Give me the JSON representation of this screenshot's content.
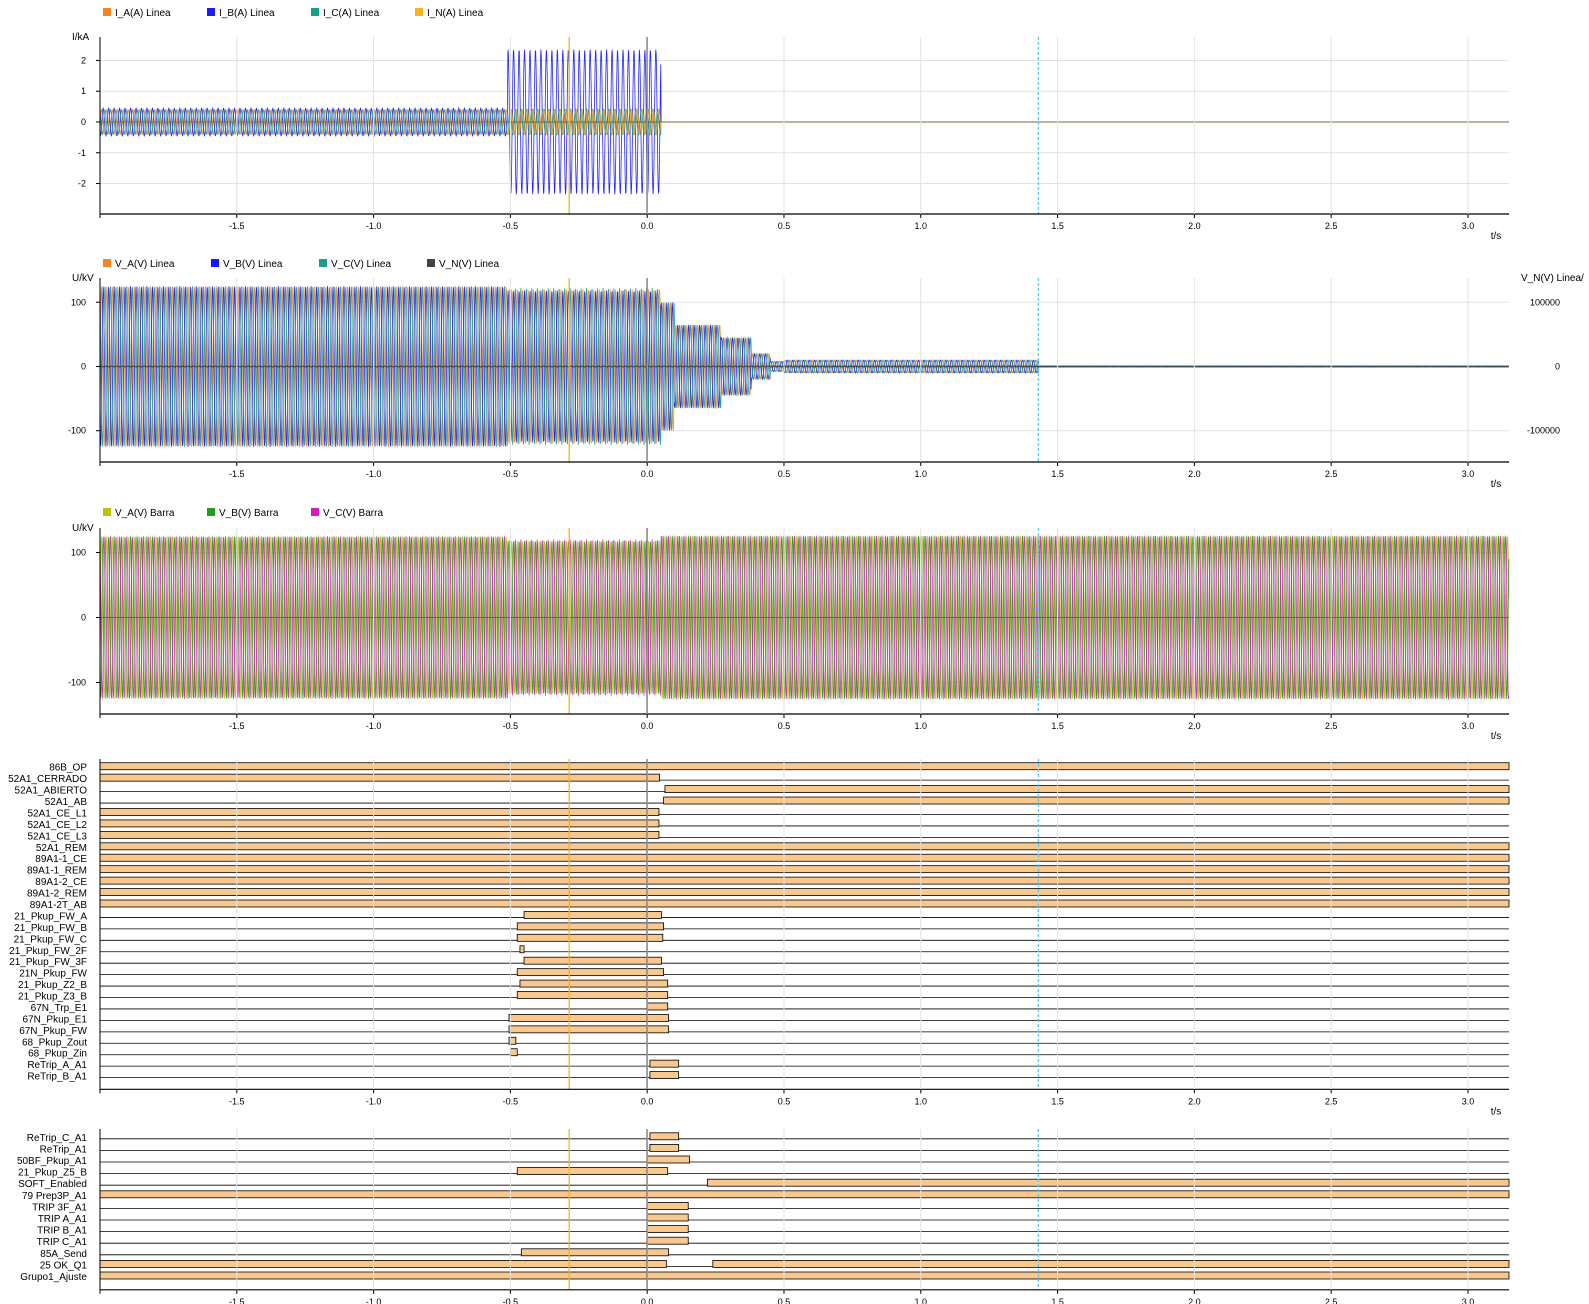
{
  "x_axis": {
    "unit_label": "t/s",
    "ticks": [
      -1.5,
      -1.0,
      -0.5,
      0.0,
      0.5,
      1.0,
      1.5,
      2.0,
      2.5,
      3.0
    ],
    "tick_labels": [
      "-1.5",
      "-1.0",
      "-0.5",
      "0.0",
      "0.5",
      "1.0",
      "1.5",
      "2.0",
      "2.5",
      "3.0"
    ],
    "range": [
      -2.0,
      3.15
    ]
  },
  "cursors": [
    {
      "name": "cursor-1",
      "t": -0.285,
      "color": "#f4b41a"
    },
    {
      "name": "cursor-2",
      "t": 1.43,
      "color": "#5ec8f0"
    },
    {
      "name": "trigger",
      "t": 0.0,
      "color": "#000000"
    }
  ],
  "chart_data": [
    {
      "type": "line",
      "ylabel": "I/kA",
      "ylim": [
        -2.6,
        2.6
      ],
      "yticks": [
        -2,
        -1,
        0,
        1,
        2
      ],
      "legend": "top-left",
      "series": [
        {
          "name": "I_A(A) Linea",
          "color": "#f7841e",
          "segments": [
            [
              -2.0,
              -0.51,
              0.4
            ],
            [
              -0.51,
              0.05,
              0.4
            ],
            [
              0.05,
              3.15,
              0
            ]
          ]
        },
        {
          "name": "I_B(A) Linea",
          "color": "#1a1aff",
          "segments": [
            [
              -2.0,
              -0.51,
              0.45
            ],
            [
              -0.51,
              0.05,
              2.35
            ],
            [
              0.05,
              3.15,
              0
            ]
          ]
        },
        {
          "name": "I_C(A) Linea",
          "color": "#1b9e8a",
          "segments": [
            [
              -2.0,
              -0.51,
              0.4
            ],
            [
              -0.51,
              0.05,
              0.42
            ],
            [
              0.05,
              3.15,
              0
            ]
          ]
        },
        {
          "name": "I_N(A) Linea",
          "color": "#f4b41a",
          "segments": [
            [
              -2.0,
              -0.51,
              0.02
            ],
            [
              -0.51,
              0.05,
              0.4
            ],
            [
              0.05,
              3.15,
              0
            ]
          ]
        }
      ]
    },
    {
      "type": "line",
      "ylabel": "U/kV",
      "ylim": [
        -130,
        130
      ],
      "yticks": [
        -100,
        0,
        100
      ],
      "y2label": "V_N(V) Linea/",
      "y2ticks": [
        -100000,
        0,
        100000
      ],
      "legend": "top-left",
      "series": [
        {
          "name": "V_A(V) Linea",
          "color": "#f7841e",
          "segments": [
            [
              -2.0,
              -0.51,
              125
            ],
            [
              -0.51,
              0.05,
              120
            ],
            [
              0.05,
              0.1,
              100
            ],
            [
              0.1,
              0.27,
              65
            ],
            [
              0.27,
              0.38,
              45
            ],
            [
              0.38,
              0.45,
              20
            ],
            [
              0.45,
              0.5,
              8
            ],
            [
              0.5,
              1.43,
              10
            ],
            [
              1.43,
              3.15,
              1
            ]
          ]
        },
        {
          "name": "V_B(V) Linea",
          "color": "#1a1aff",
          "segments": [
            [
              -2.0,
              -0.51,
              125
            ],
            [
              -0.51,
              0.05,
              118
            ],
            [
              0.05,
              0.1,
              100
            ],
            [
              0.1,
              0.27,
              65
            ],
            [
              0.27,
              0.38,
              45
            ],
            [
              0.38,
              0.45,
              20
            ],
            [
              0.45,
              0.5,
              8
            ],
            [
              0.5,
              1.43,
              10
            ],
            [
              1.43,
              3.15,
              1
            ]
          ]
        },
        {
          "name": "V_C(V) Linea",
          "color": "#1b9e8a",
          "segments": [
            [
              -2.0,
              -0.51,
              125
            ],
            [
              -0.51,
              0.05,
              122
            ],
            [
              0.05,
              0.1,
              100
            ],
            [
              0.1,
              0.27,
              65
            ],
            [
              0.27,
              0.38,
              45
            ],
            [
              0.38,
              0.45,
              20
            ],
            [
              0.45,
              0.5,
              8
            ],
            [
              0.5,
              1.43,
              10
            ],
            [
              1.43,
              3.15,
              1
            ]
          ]
        },
        {
          "name": "V_N(V) Linea",
          "color": "#444444",
          "segments": [
            [
              -2.0,
              3.15,
              1
            ]
          ]
        }
      ]
    },
    {
      "type": "line",
      "ylabel": "U/kV",
      "ylim": [
        -130,
        130
      ],
      "yticks": [
        -100,
        0,
        100
      ],
      "legend": "top-left",
      "series": [
        {
          "name": "V_A(V) Barra",
          "color": "#b8c400",
          "segments": [
            [
              -2.0,
              -0.51,
              125
            ],
            [
              -0.51,
              0.05,
              118
            ],
            [
              0.05,
              3.15,
              126
            ]
          ]
        },
        {
          "name": "V_B(V) Barra",
          "color": "#1e9e1e",
          "segments": [
            [
              -2.0,
              -0.51,
              125
            ],
            [
              -0.51,
              0.05,
              118
            ],
            [
              0.05,
              3.15,
              126
            ]
          ]
        },
        {
          "name": "V_C(V) Barra",
          "color": "#d41ec0",
          "segments": [
            [
              -2.0,
              -0.51,
              125
            ],
            [
              -0.51,
              0.05,
              120
            ],
            [
              0.05,
              3.15,
              126
            ]
          ]
        }
      ]
    },
    {
      "type": "digital",
      "channels": [
        {
          "name": "86B_OP",
          "on": [
            [
              -2.0,
              3.15
            ]
          ]
        },
        {
          "name": "52A1_CERRADO",
          "on": [
            [
              -2.0,
              0.045
            ]
          ]
        },
        {
          "name": "52A1_ABIERTO",
          "on": [
            [
              0.065,
              3.15
            ]
          ]
        },
        {
          "name": "52A1_AB",
          "on": [
            [
              0.06,
              3.15
            ]
          ]
        },
        {
          "name": "52A1_CE_L1",
          "on": [
            [
              -2.0,
              0.043
            ]
          ]
        },
        {
          "name": "52A1_CE_L2",
          "on": [
            [
              -2.0,
              0.043
            ]
          ]
        },
        {
          "name": "52A1_CE_L3",
          "on": [
            [
              -2.0,
              0.043
            ]
          ]
        },
        {
          "name": "52A1_REM",
          "on": [
            [
              -2.0,
              3.15
            ]
          ]
        },
        {
          "name": "89A1-1_CE",
          "on": [
            [
              -2.0,
              3.15
            ]
          ]
        },
        {
          "name": "89A1-1_REM",
          "on": [
            [
              -2.0,
              3.15
            ]
          ]
        },
        {
          "name": "89A1-2_CE",
          "on": [
            [
              -2.0,
              3.15
            ]
          ]
        },
        {
          "name": "89A1-2_REM",
          "on": [
            [
              -2.0,
              3.15
            ]
          ]
        },
        {
          "name": "89A1-2T_AB",
          "on": [
            [
              -2.0,
              3.15
            ]
          ]
        },
        {
          "name": "21_Pkup_FW_A",
          "on": [
            [
              -0.45,
              0.052
            ]
          ]
        },
        {
          "name": "21_Pkup_FW_B",
          "on": [
            [
              -0.475,
              0.06
            ]
          ]
        },
        {
          "name": "21_Pkup_FW_C",
          "on": [
            [
              -0.475,
              0.057
            ]
          ]
        },
        {
          "name": "21_Pkup_FW_2F",
          "on": [
            [
              -0.465,
              -0.45
            ]
          ]
        },
        {
          "name": "21_Pkup_FW_3F",
          "on": [
            [
              -0.45,
              0.052
            ]
          ]
        },
        {
          "name": "21N_Pkup_FW",
          "on": [
            [
              -0.475,
              0.06
            ]
          ]
        },
        {
          "name": "21_Pkup_Z2_B",
          "on": [
            [
              -0.465,
              0.075
            ]
          ]
        },
        {
          "name": "21_Pkup_Z3_B",
          "on": [
            [
              -0.475,
              0.075
            ]
          ]
        },
        {
          "name": "67N_Trp_E1",
          "on": [
            [
              0.0,
              0.075
            ]
          ]
        },
        {
          "name": "67N_Pkup_E1",
          "on": [
            [
              -0.505,
              0.078
            ]
          ]
        },
        {
          "name": "67N_Pkup_FW",
          "on": [
            [
              -0.505,
              0.078
            ]
          ]
        },
        {
          "name": "68_Pkup_Zout",
          "on": [
            [
              -0.505,
              -0.48
            ]
          ]
        },
        {
          "name": "68_Pkup_Zin",
          "on": [
            [
              -0.5,
              -0.475
            ]
          ]
        },
        {
          "name": "ReTrip_A_A1",
          "on": [
            [
              0.01,
              0.115
            ]
          ]
        },
        {
          "name": "ReTrip_B_A1",
          "on": [
            [
              0.01,
              0.115
            ]
          ]
        }
      ]
    },
    {
      "type": "digital",
      "channels": [
        {
          "name": "ReTrip_C_A1",
          "on": [
            [
              0.01,
              0.115
            ]
          ]
        },
        {
          "name": "ReTrip_A1",
          "on": [
            [
              0.01,
              0.115
            ]
          ]
        },
        {
          "name": "50BF_Pkup_A1",
          "on": [
            [
              0.0,
              0.155
            ]
          ]
        },
        {
          "name": "21_Pkup_Z5_B",
          "on": [
            [
              -0.475,
              0.075
            ]
          ]
        },
        {
          "name": "SOFT_Enabled",
          "on": [
            [
              0.22,
              3.15
            ]
          ]
        },
        {
          "name": "79 Prep3P_A1",
          "on": [
            [
              -2.0,
              3.15
            ]
          ]
        },
        {
          "name": "TRIP 3F_A1",
          "on": [
            [
              0.0,
              0.15
            ]
          ]
        },
        {
          "name": "TRIP A_A1",
          "on": [
            [
              0.0,
              0.15
            ]
          ]
        },
        {
          "name": "TRIP B_A1",
          "on": [
            [
              0.0,
              0.15
            ]
          ]
        },
        {
          "name": "TRIP C_A1",
          "on": [
            [
              0.0,
              0.15
            ]
          ]
        },
        {
          "name": "85A_Send",
          "on": [
            [
              -0.46,
              0.078
            ]
          ]
        },
        {
          "name": "25 OK_Q1",
          "on": [
            [
              -2.0,
              0.07
            ],
            [
              0.24,
              3.15
            ]
          ]
        },
        {
          "name": "Grupo1_Ajuste",
          "on": [
            [
              -2.0,
              3.15
            ]
          ]
        }
      ]
    }
  ]
}
